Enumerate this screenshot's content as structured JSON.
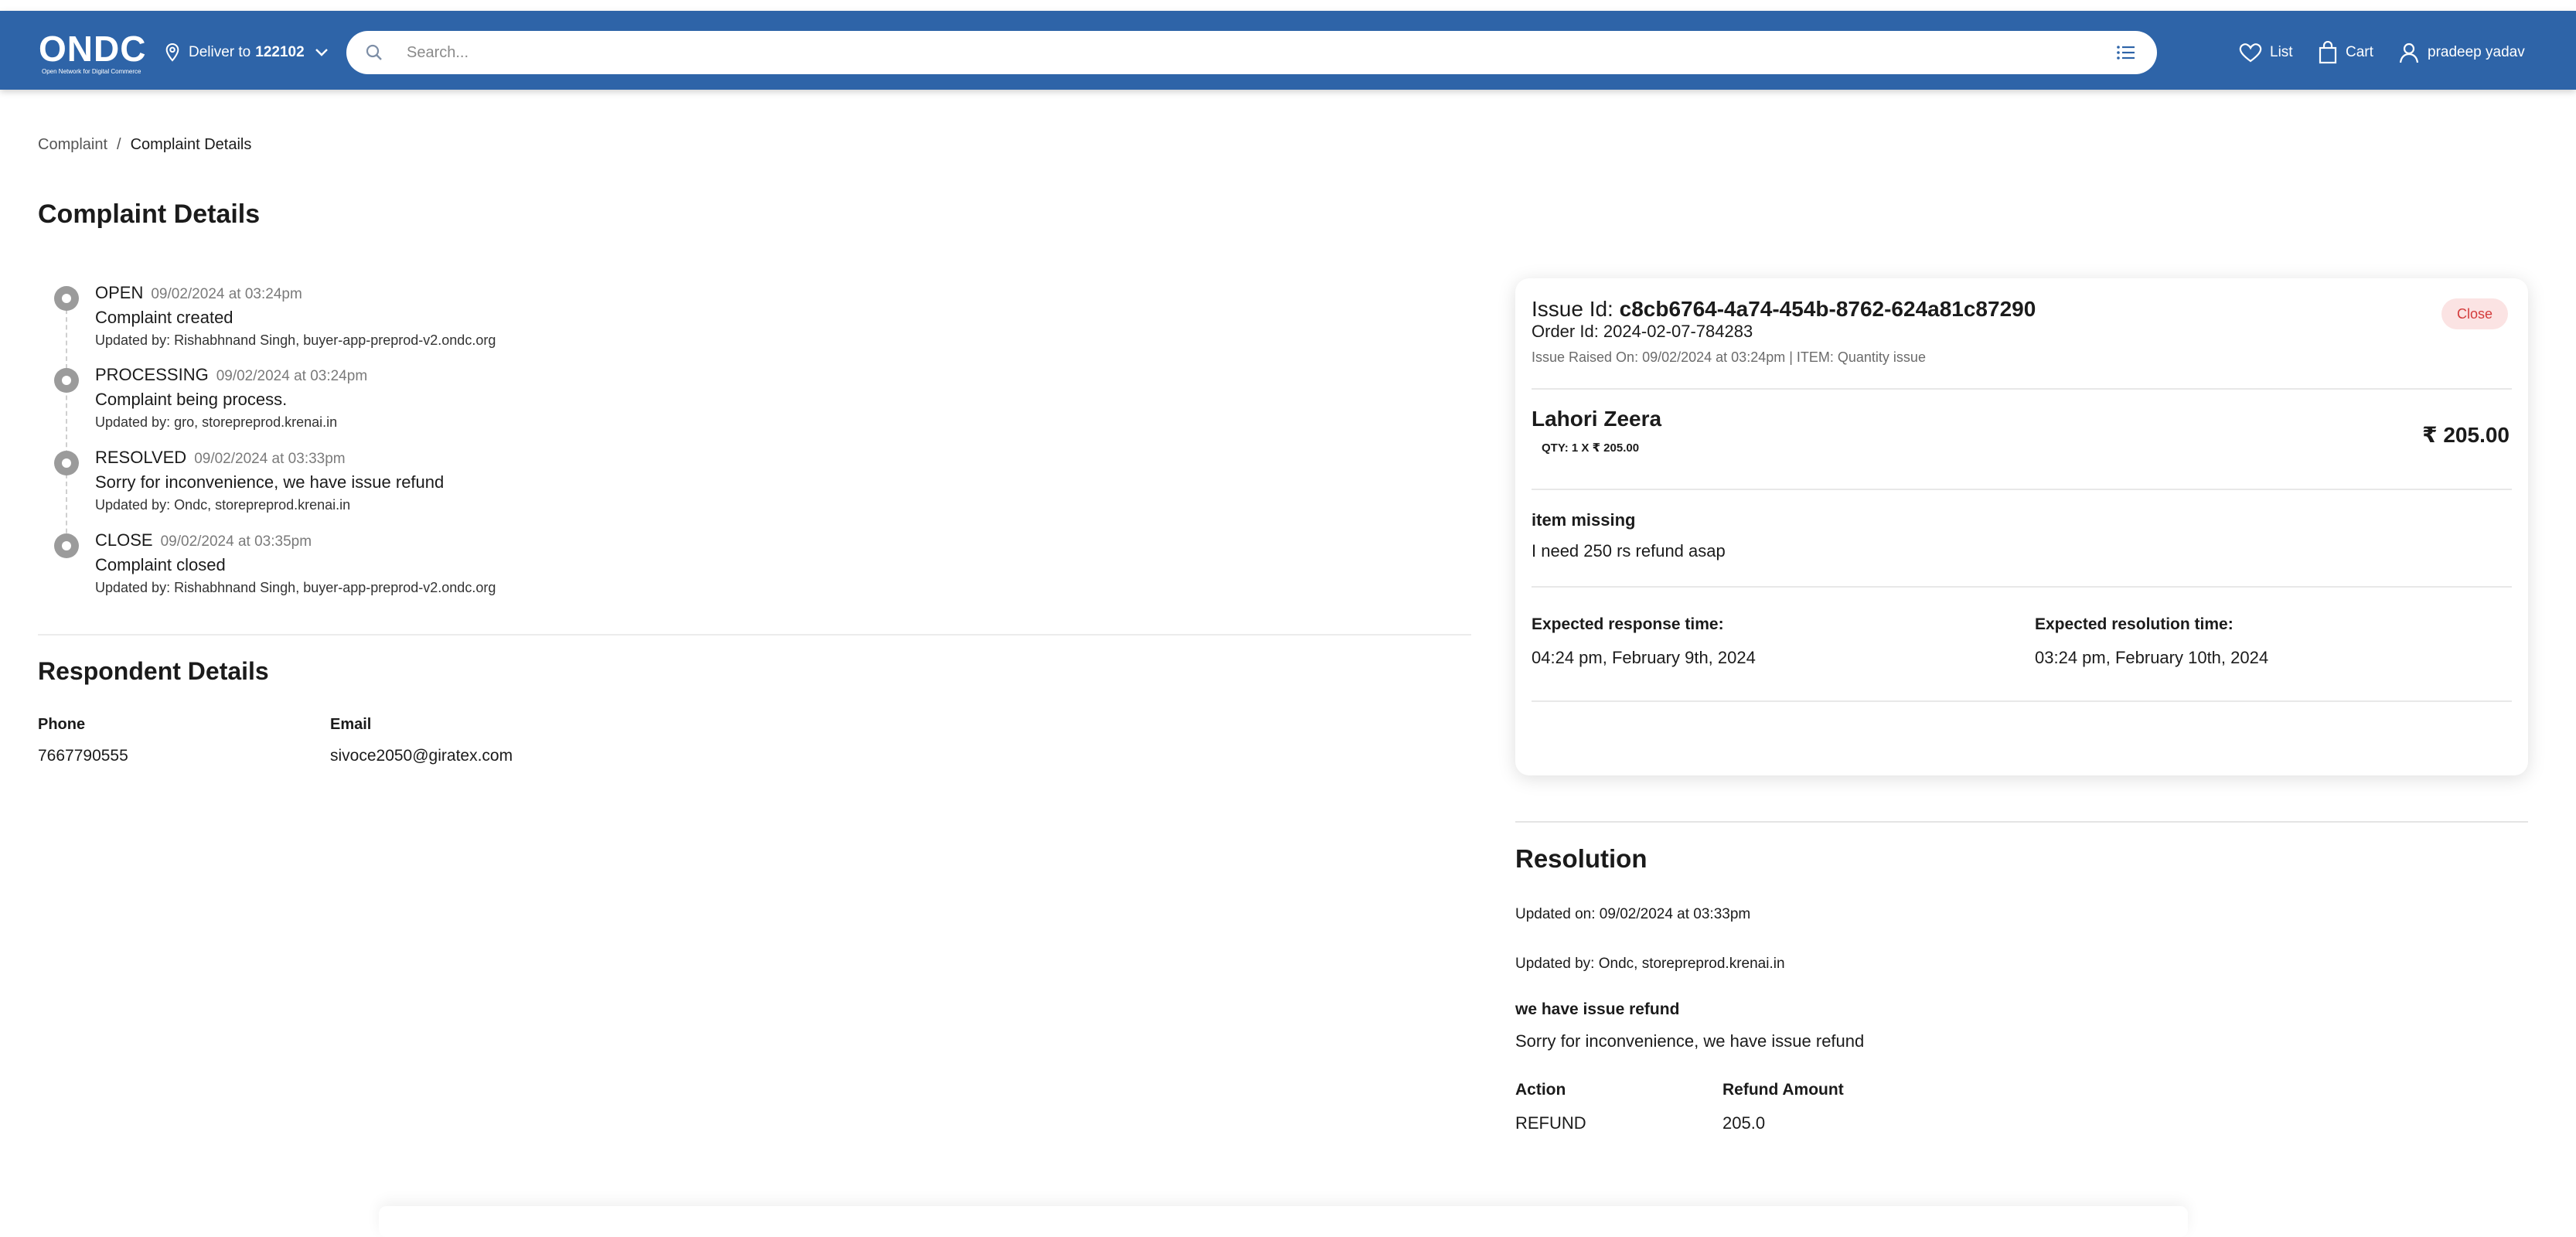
{
  "header": {
    "logo_text": "ONDC",
    "logo_tagline": "Open Network for Digital Commerce",
    "deliver_prefix": "Deliver to",
    "deliver_pincode": "122102",
    "search_placeholder": "Search...",
    "list_label": "List",
    "cart_label": "Cart",
    "user_name": "pradeep yadav"
  },
  "breadcrumb": {
    "items": [
      "Complaint",
      "Complaint Details"
    ],
    "separator": "/"
  },
  "page_title": "Complaint Details",
  "timeline": [
    {
      "status": "OPEN",
      "time": "09/02/2024 at 03:24pm",
      "description": "Complaint created",
      "updated_by": "Updated by: Rishabhnand Singh, buyer-app-preprod-v2.ondc.org"
    },
    {
      "status": "PROCESSING",
      "time": "09/02/2024 at 03:24pm",
      "description": "Complaint being process.",
      "updated_by": "Updated by: gro, storepreprod.krenai.in"
    },
    {
      "status": "RESOLVED",
      "time": "09/02/2024 at 03:33pm",
      "description": "Sorry for inconvenience, we have issue refund",
      "updated_by": "Updated by: Ondc, storepreprod.krenai.in"
    },
    {
      "status": "CLOSE",
      "time": "09/02/2024 at 03:35pm",
      "description": "Complaint closed",
      "updated_by": "Updated by: Rishabhnand Singh, buyer-app-preprod-v2.ondc.org"
    }
  ],
  "respondent": {
    "title": "Respondent Details",
    "phone_label": "Phone",
    "phone": "7667790555",
    "email_label": "Email",
    "email": "sivoce2050@giratex.com"
  },
  "issue_card": {
    "issue_id_label": "Issue Id:",
    "issue_id": "c8cb6764-4a74-454b-8762-624a81c87290",
    "order_id": "Order Id: 2024-02-07-784283",
    "raised": "Issue Raised On: 09/02/2024 at 03:24pm | ITEM: Quantity issue",
    "close_button": "Close",
    "product_name": "Lahori Zeera",
    "product_qty": "QTY: 1 X ₹ 205.00",
    "product_price": "₹ 205.00",
    "issue_short": "item missing",
    "issue_long": "I need 250 rs refund asap",
    "expected_response_label": "Expected response time:",
    "expected_response": "04:24 pm, February 9th, 2024",
    "expected_resolution_label": "Expected resolution time:",
    "expected_resolution": "03:24 pm, February 10th, 2024"
  },
  "resolution": {
    "title": "Resolution",
    "updated_on": "Updated on: 09/02/2024 at 03:33pm",
    "updated_by": "Updated by: Ondc, storepreprod.krenai.in",
    "short_desc": "we have issue refund",
    "long_desc": "Sorry for inconvenience, we have issue refund",
    "action_label": "Action",
    "action": "REFUND",
    "refund_label": "Refund Amount",
    "refund": "205.0"
  },
  "colors": {
    "navbar": "#2e64a8",
    "close_bg": "#fbe3e3",
    "close_text": "#d33b3b",
    "timeline_dot": "#9b9b9b"
  },
  "icons": [
    "location-pin-icon",
    "chevron-down-icon",
    "search-icon",
    "filter-list-icon",
    "heart-icon",
    "cart-bag-icon",
    "user-icon"
  ]
}
